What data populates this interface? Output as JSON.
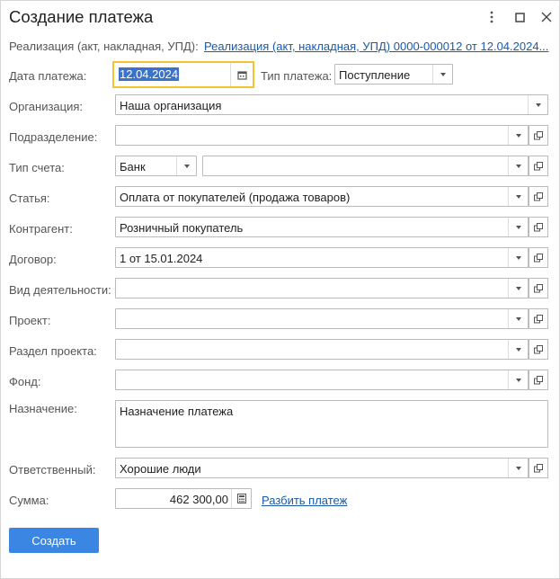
{
  "window": {
    "title": "Создание платежа"
  },
  "basis": {
    "label": "Реализация (акт, накладная, УПД):",
    "link": "Реализация (акт, накладная, УПД) 0000-000012 от 12.04.2024..."
  },
  "date": {
    "label": "Дата платежа:",
    "value": "12.04.2024"
  },
  "payment_type": {
    "label": "Тип платежа:",
    "value": "Поступление"
  },
  "organization": {
    "label": "Организация:",
    "value": "Наша организация"
  },
  "division": {
    "label": "Подразделение:",
    "value": ""
  },
  "account_type": {
    "label": "Тип счета:",
    "value": "Банк",
    "account": ""
  },
  "article": {
    "label": "Статья:",
    "value": "Оплата от покупателей (продажа товаров)"
  },
  "counterparty": {
    "label": "Контрагент:",
    "value": "Розничный покупатель"
  },
  "contract": {
    "label": "Договор:",
    "value": "1 от 15.01.2024"
  },
  "activity": {
    "label": "Вид деятельности:",
    "value": ""
  },
  "project": {
    "label": "Проект:",
    "value": ""
  },
  "project_section": {
    "label": "Раздел проекта:",
    "value": ""
  },
  "fund": {
    "label": "Фонд:",
    "value": ""
  },
  "purpose": {
    "label": "Назначение:",
    "value": "",
    "placeholder": "Назначение платежа"
  },
  "responsible": {
    "label": "Ответственный:",
    "value": "Хорошие люди"
  },
  "amount": {
    "label": "Сумма:",
    "value": "462 300,00",
    "split_link": "Разбить платеж"
  },
  "actions": {
    "create": "Создать"
  },
  "colors": {
    "accent": "#3b86e2",
    "focus": "#f2c230",
    "link": "#1a5aa8"
  }
}
